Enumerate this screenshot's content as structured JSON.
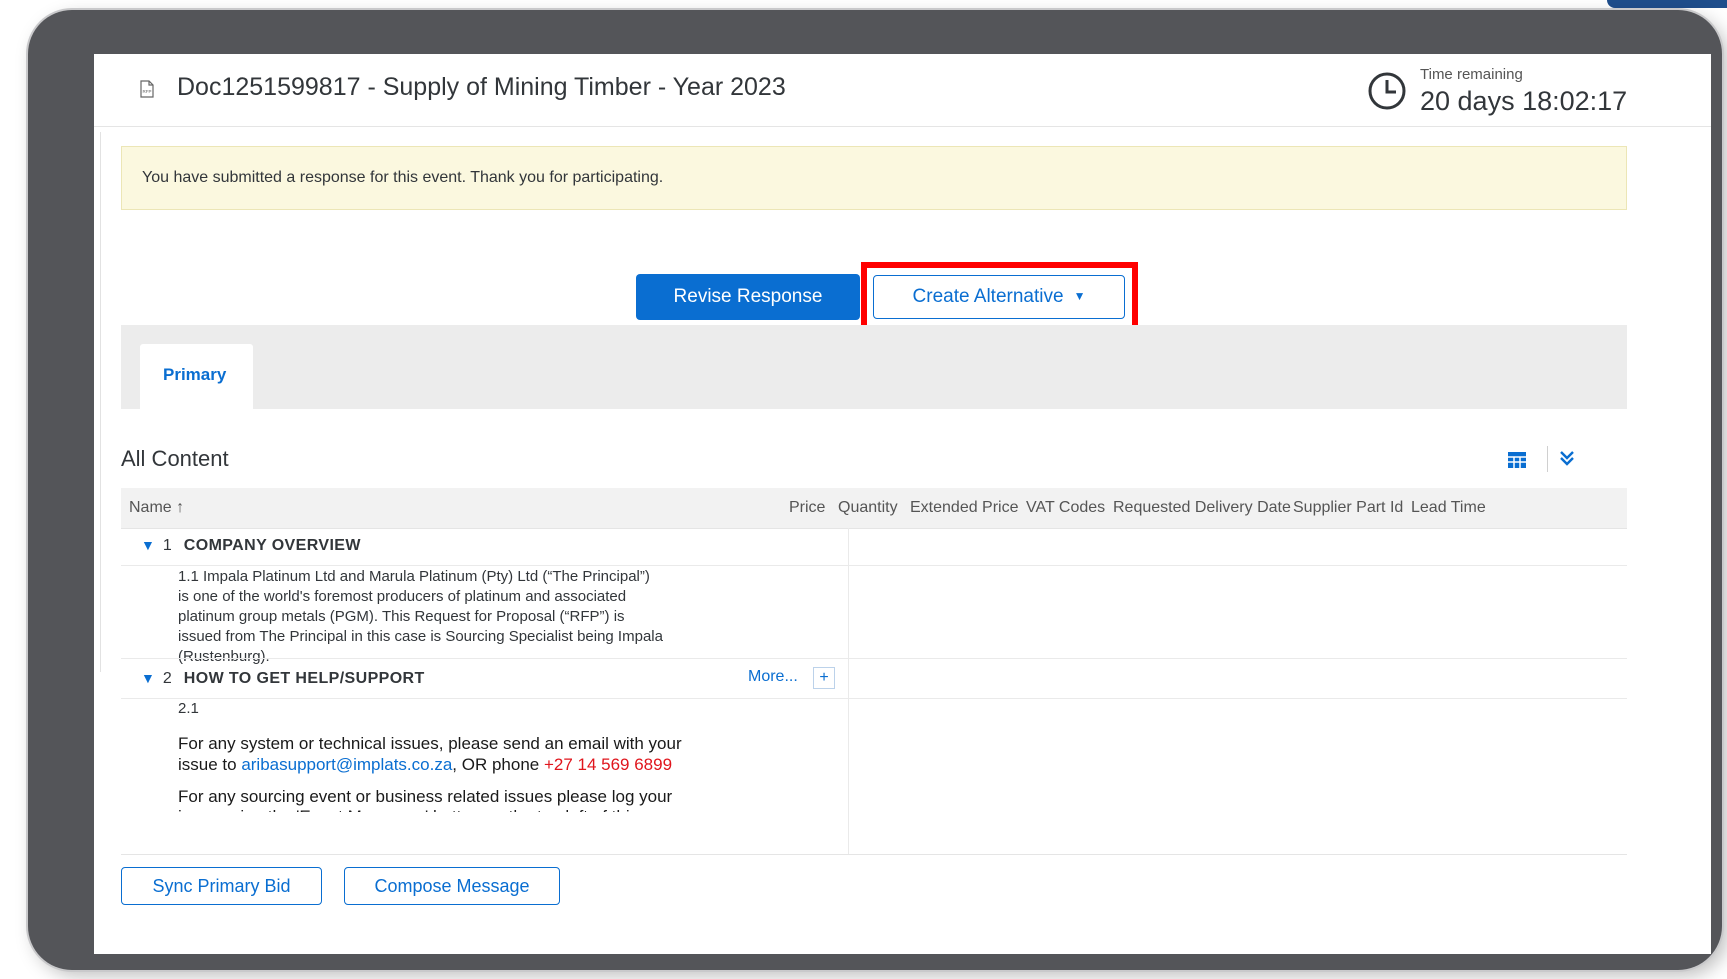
{
  "header": {
    "doc_title": "Doc1251599817 - Supply of Mining Timber - Year 2023",
    "doc_icon": "rfp-document-icon",
    "time_label": "Time remaining",
    "time_value": "20 days 18:02:17",
    "clock_icon": "clock-icon"
  },
  "notice": {
    "text": "You have submitted a response for this event.  Thank you for participating."
  },
  "actions": {
    "revise_label": "Revise Response",
    "create_alt_label": "Create Alternative",
    "create_alt_caret": "▼",
    "highlight_color": "#ff0000"
  },
  "tabs": [
    {
      "label": "Primary",
      "active": true
    }
  ],
  "content": {
    "title": "All Content",
    "columns": [
      "Name ↑",
      "Price",
      "Quantity",
      "Extended Price",
      "VAT Codes",
      "Requested Delivery Date",
      "Supplier Part Id",
      "Lead Time"
    ],
    "sections": [
      {
        "toggle": "▼",
        "number": "1",
        "name": "COMPANY OVERVIEW",
        "item_lines": [
          "1.1   Impala Platinum Ltd and Marula Platinum (Pty) Ltd (“The Principal”)",
          "is one of the world's foremost producers of platinum and associated",
          "platinum group metals (PGM).  This Request for Proposal (“RFP”) is",
          "issued from The Principal in this case is Sourcing Specialist being Impala",
          "(Rustenburg)."
        ]
      },
      {
        "toggle": "▼",
        "number": "2",
        "name": "HOW TO GET HELP/SUPPORT",
        "more_label": "More...",
        "plus_label": "+",
        "item_number": "2.1",
        "help_line1": "For any system or technical issues, please send an email with your",
        "help_line2_prefix": "issue to ",
        "email": "aribasupport@implats.co.za",
        "help_line2_mid": ", OR phone ",
        "phone": "+27 14 569 6899",
        "help_line3": "For any sourcing event or business related issues please log your",
        "help_line4_cut": "issue using the 'Event Messages' button on the top left of this"
      }
    ]
  },
  "footer": {
    "sync_label": "Sync Primary Bid",
    "compose_label": "Compose Message"
  },
  "colors": {
    "accent": "#0a6ed1",
    "notice_bg": "#fbf8df",
    "frame": "#545559",
    "phone_red": "#e0151c"
  }
}
